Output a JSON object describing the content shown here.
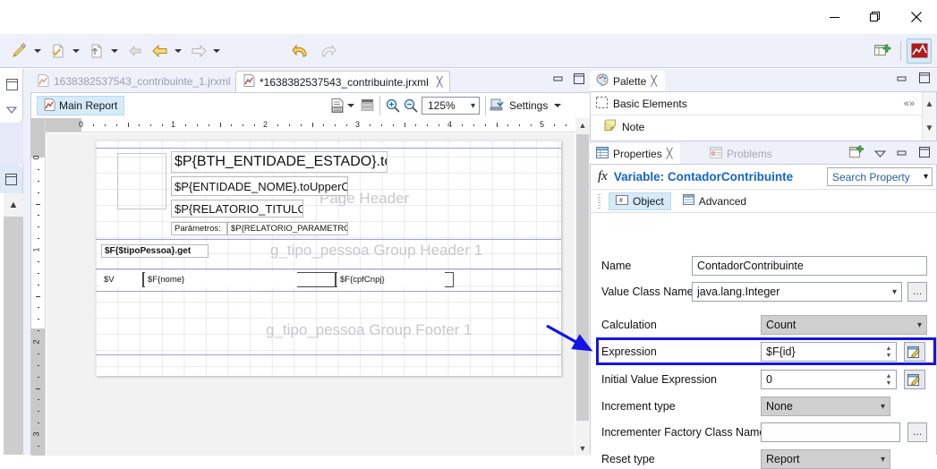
{
  "window": {
    "minimize_label": "Minimize",
    "restore_label": "Restore",
    "close_label": "Close"
  },
  "toolbar": {
    "items": [
      {
        "name": "run-report",
        "icon": "pen-run-icon",
        "has_caret": true
      },
      {
        "name": "new-file",
        "icon": "new-document-icon",
        "has_caret": true
      },
      {
        "name": "export",
        "icon": "export-document-icon",
        "has_caret": true
      },
      {
        "name": "back-disabled",
        "icon": "back-arrow-grey-icon",
        "has_caret": false
      },
      {
        "name": "back",
        "icon": "back-arrow-yellow-icon",
        "has_caret": true
      },
      {
        "name": "forward",
        "icon": "forward-arrow-grey-icon",
        "has_caret": true
      }
    ],
    "undo": {
      "name": "undo-button",
      "icon": "undo-arrow-icon"
    },
    "redo": {
      "name": "redo-button",
      "icon": "redo-arrow-icon"
    },
    "perspective_new": {
      "name": "open-perspective-button",
      "icon": "new-perspective-icon"
    },
    "perspective_active": {
      "name": "report-perspective-button",
      "icon": "jasper-report-icon"
    }
  },
  "editor": {
    "tabs": [
      {
        "label": "1638382537543_contribuinte_1.jrxml",
        "active": false,
        "closeable": false
      },
      {
        "label": "*1638382537543_contribuinte.jrxml",
        "active": true,
        "closeable": true,
        "close_label": "╳"
      }
    ],
    "tab_controls": {
      "minimize": "–",
      "maximize": "❐"
    },
    "main_report_tab": "Main Report",
    "zoom_value": "125%",
    "settings_label": "Settings",
    "zoom_in_label": "Zoom In",
    "zoom_out_label": "Zoom Out",
    "ruler": {
      "horizontal_labels": [
        "0",
        "1",
        "2",
        "3",
        "4",
        "5"
      ],
      "vertical_labels": [
        "0",
        "1",
        "2",
        "3"
      ]
    },
    "bands": [
      {
        "label": "Page Header",
        "name": "band-label-page-header"
      },
      {
        "label": "g_tipo_pessoa Group Header 1",
        "name": "band-label-group-header"
      },
      {
        "label": "g_tipo_pessoa Group Footer 1",
        "name": "band-label-group-footer"
      }
    ],
    "elements": [
      {
        "name": "logo-placeholder",
        "text": ""
      },
      {
        "name": "field-entidade-estado",
        "text": "$P{BTH_ENTIDADE_ESTADO}.toUpperCase()"
      },
      {
        "name": "field-entidade-nome",
        "text": "$P{ENTIDADE_NOME}.toUpperCase()"
      },
      {
        "name": "field-relatorio-titulo",
        "text": "$P{RELATORIO_TITULO}"
      },
      {
        "name": "label-parametros",
        "text": "Parâmetros:"
      },
      {
        "name": "field-relatorio-parametros",
        "text": "$P{RELATORIO_PARAMETROS}"
      },
      {
        "name": "field-tipo-pessoa",
        "text": "$F{$tipoPessoa}.get"
      },
      {
        "name": "field-variable-v",
        "text": "$V"
      },
      {
        "name": "field-nome",
        "text": "$F{nome}"
      },
      {
        "name": "field-cpf-cnpj",
        "text": "$F{cpfCnpj}"
      }
    ]
  },
  "palette": {
    "tab_label": "Palette",
    "tab_close": "╳",
    "group_label": "Basic Elements",
    "collapse_label": "«",
    "items": [
      {
        "label": "Note",
        "icon": "note-icon"
      }
    ],
    "controls": {
      "minimize": "–",
      "maximize": "❐"
    }
  },
  "properties": {
    "tabs": [
      {
        "label": "Properties",
        "active": true,
        "close": "╳"
      },
      {
        "label": "Problems",
        "active": false
      }
    ],
    "controls": {
      "pin": "new-view-icon",
      "menu": "▽",
      "minimize": "–",
      "maximize": "❐"
    },
    "title_prefix": "fx",
    "title": "Variable: ContadorContribuinte",
    "title_color": "#1464c8",
    "search_placeholder": "Search Property",
    "object_tabs": [
      {
        "label": "Object",
        "selected": true,
        "icon": "object-icon"
      },
      {
        "label": "Advanced",
        "selected": false,
        "icon": "advanced-icon"
      }
    ],
    "fields": [
      {
        "label": "Name",
        "type": "text",
        "value": "ContadorContribuinte",
        "name": "name-field"
      },
      {
        "label": "Value Class Name",
        "type": "combo",
        "value": "java.lang.Integer",
        "name": "value-class-name-field",
        "has_dots": true
      },
      {
        "label": "Calculation",
        "type": "combo-grey",
        "value": "Count",
        "name": "calculation-field"
      },
      {
        "label": "Expression",
        "type": "spinner",
        "value": "$F{id}",
        "name": "expression-field",
        "has_edit": true
      },
      {
        "label": "Initial Value Expression",
        "type": "spinner",
        "value": "0",
        "name": "initial-value-expression-field",
        "has_edit": true,
        "highlighted": true
      },
      {
        "label": "Increment type",
        "type": "combo-grey",
        "value": "None",
        "name": "increment-type-field"
      },
      {
        "label": "Incrementer Factory Class Name",
        "type": "text",
        "value": "",
        "name": "incrementer-factory-class-name-field",
        "has_dots": true
      },
      {
        "label": "Reset type",
        "type": "combo-grey",
        "value": "Report",
        "name": "reset-type-field"
      }
    ],
    "highlight_color": "#1414e6"
  },
  "annotation": {
    "arrow_color": "#1414e6",
    "arrow_name": "callout-arrow"
  }
}
